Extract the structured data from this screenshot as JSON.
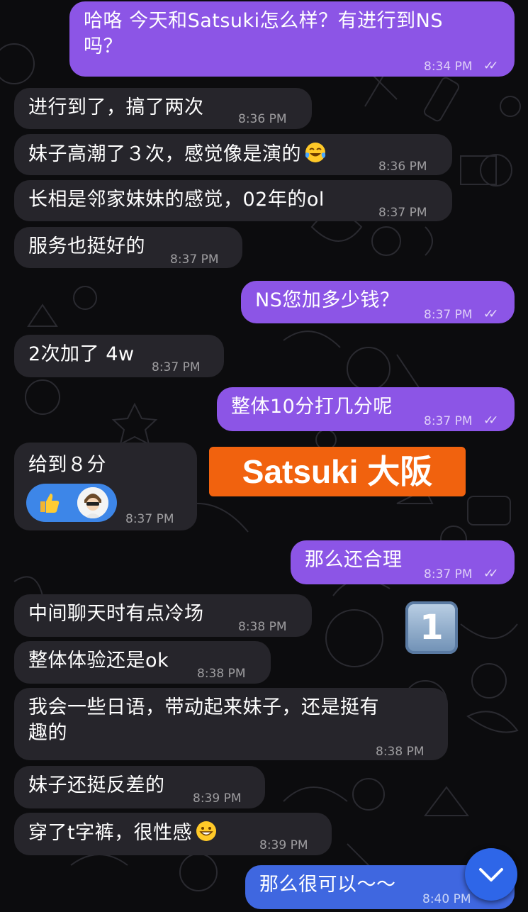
{
  "colors": {
    "background": "#0c0c0e",
    "incoming_bubble": "#26252b",
    "outgoing_bubble": "#8c55e6",
    "outgoing_bubble_last": "#3f67e0",
    "overlay_label": "#f1620e",
    "scroll_button": "#2e66e8"
  },
  "messages": [
    {
      "dir": "out",
      "line1": "哈咯 今天和Satsuki怎么样？有进行到NS",
      "line2": "吗？",
      "time": "8:34 PM",
      "read": "✓✓"
    },
    {
      "dir": "in",
      "text": "进行到了，搞了两次",
      "time": "8:36 PM"
    },
    {
      "dir": "in",
      "text": "妹子高潮了３次，感觉像是演的",
      "emoji": "face-with-tears-of-joy-icon",
      "time": "8:36 PM"
    },
    {
      "dir": "in",
      "text": "长相是邻家妹妹的感觉，02年的ol",
      "time": "8:37 PM"
    },
    {
      "dir": "in",
      "text": "服务也挺好的",
      "time": "8:37 PM"
    },
    {
      "dir": "out",
      "text": "NS您加多少钱？",
      "time": "8:37 PM",
      "read": "✓✓"
    },
    {
      "dir": "in",
      "text": "2次加了 4w",
      "time": "8:37 PM"
    },
    {
      "dir": "out",
      "text": "整体10分打几分呢",
      "time": "8:37 PM",
      "read": "✓✓"
    },
    {
      "dir": "in",
      "text": "给到８分",
      "reaction": "thumbs-up-icon",
      "time": "8:37 PM"
    },
    {
      "dir": "out",
      "text": "那么还合理",
      "time": "8:37 PM",
      "read": "✓✓"
    },
    {
      "dir": "in",
      "text": "中间聊天时有点冷场",
      "time": "8:38 PM"
    },
    {
      "dir": "in",
      "text": "整体体验还是ok",
      "time": "8:38 PM"
    },
    {
      "dir": "in",
      "line1": "我会一些日语，带动起来妹子，还是挺有",
      "line2": "趣的",
      "time": "8:38 PM"
    },
    {
      "dir": "in",
      "text": "妹子还挺反差的",
      "time": "8:39 PM"
    },
    {
      "dir": "in",
      "text": "穿了t字裤，很性感",
      "emoji": "grinning-face-icon",
      "time": "8:39 PM"
    },
    {
      "dir": "out",
      "text": "那么很可以～～",
      "time": "8:40 PM"
    }
  ],
  "overlay": {
    "label": "Satsuki 大阪",
    "badge": "1"
  },
  "scroll_button_icon": "chevron-down-icon"
}
